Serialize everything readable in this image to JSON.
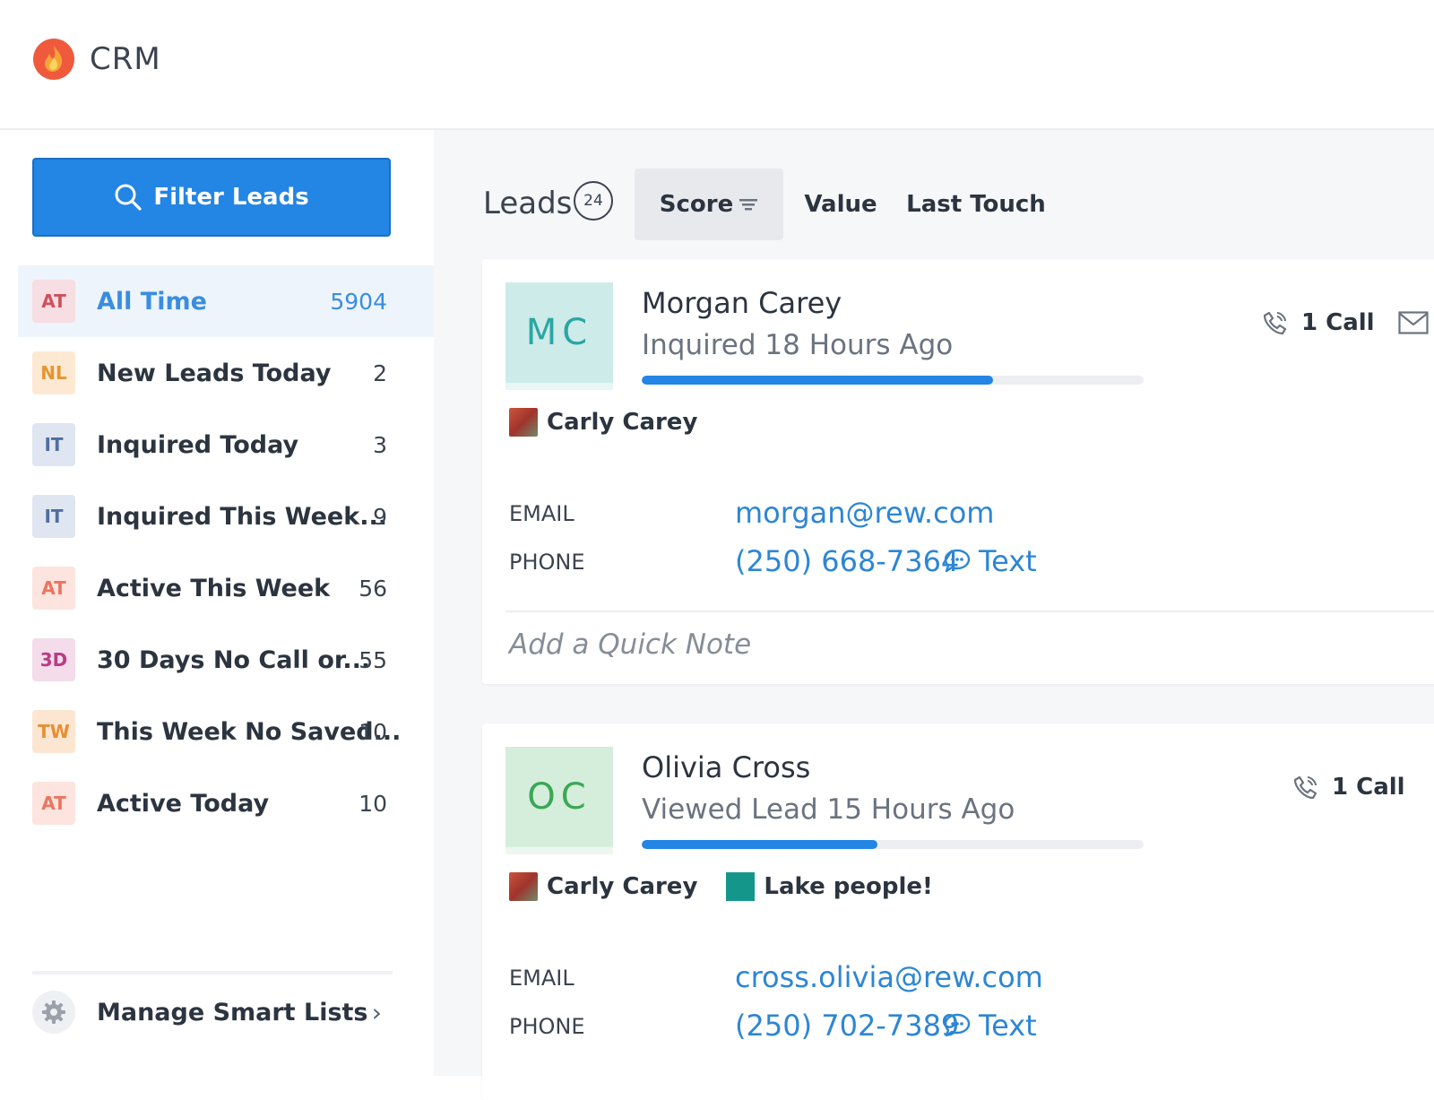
{
  "app": {
    "title": "CRM",
    "logo_icon": "flame-logo-icon"
  },
  "sidebar": {
    "filter_button": "Filter Leads",
    "lists": [
      {
        "badge": "AT",
        "label": "All Time",
        "count": "5904",
        "active": true
      },
      {
        "badge": "NL",
        "label": "New Leads Today",
        "count": "2"
      },
      {
        "badge": "IT",
        "label": "Inquired Today",
        "count": "3"
      },
      {
        "badge": "IT",
        "label": "Inquired This Week...",
        "count": "9"
      },
      {
        "badge": "AT",
        "label": "Active This Week",
        "count": "56"
      },
      {
        "badge": "3D",
        "label": "30 Days No Call or...",
        "count": "55"
      },
      {
        "badge": "TW",
        "label": "This Week No Saved...",
        "count": "10"
      },
      {
        "badge": "AT",
        "label": "Active Today",
        "count": "10"
      }
    ],
    "manage_label": "Manage Smart Lists"
  },
  "main": {
    "title": "Leads",
    "count": "24",
    "tabs": [
      {
        "label": "Score",
        "selected": true
      },
      {
        "label": "Value"
      },
      {
        "label": "Last Touch"
      }
    ],
    "leads": [
      {
        "initials": "MC",
        "name": "Morgan Carey",
        "status": "Inquired 18 Hours Ago",
        "score_fraction": 0.7,
        "agent": "Carly Carey",
        "calls": "1 Call",
        "email_label": "EMAIL",
        "email": "morgan@rew.com",
        "phone_label": "PHONE",
        "phone": "(250) 668-7364",
        "text_label": "Text",
        "note_placeholder": "Add a Quick Note"
      },
      {
        "initials": "OC",
        "name": "Olivia Cross",
        "status": "Viewed Lead 15 Hours Ago",
        "score_fraction": 0.47,
        "agent": "Carly Carey",
        "tag": "Lake people!",
        "tag_color": "#15968a",
        "calls": "1 Call",
        "email_label": "EMAIL",
        "email": "cross.olivia@rew.com",
        "phone_label": "PHONE",
        "phone": "(250) 702-7389",
        "text_label": "Text"
      }
    ]
  },
  "colors": {
    "accent": "#2385e4",
    "link": "#2d86d4",
    "active_row": "#edf4fc"
  }
}
